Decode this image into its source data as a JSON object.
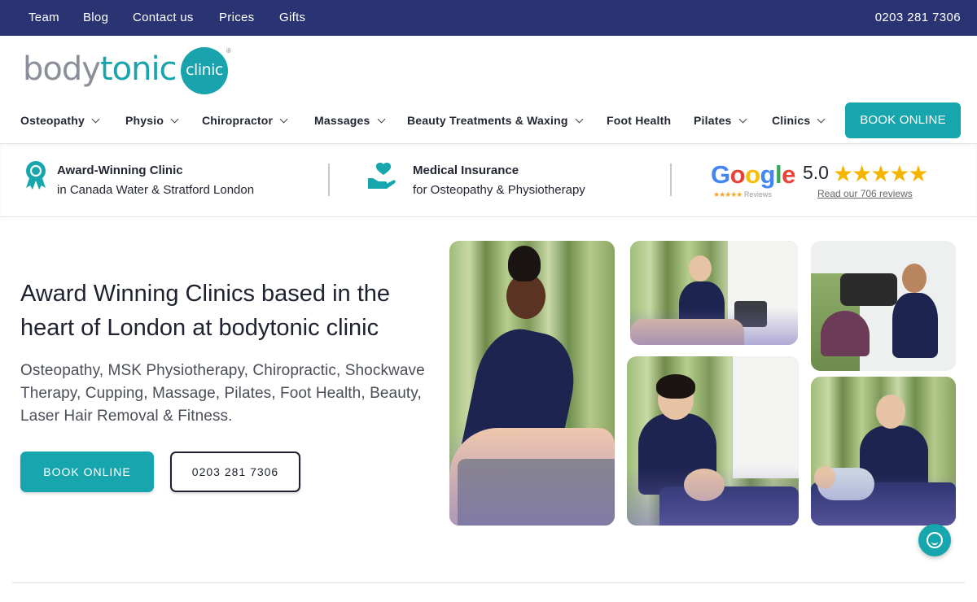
{
  "topbar": {
    "links": [
      "Team",
      "Blog",
      "Contact us",
      "Prices",
      "Gifts"
    ],
    "phone": "0203 281 7306"
  },
  "logo": {
    "word_prefix": "body",
    "word_suffix": "tonic",
    "badge": "clinic"
  },
  "nav": {
    "items": [
      {
        "label": "Osteopathy",
        "dropdown": true
      },
      {
        "label": "Physio",
        "dropdown": true
      },
      {
        "label": "Chiropractor",
        "dropdown": true
      },
      {
        "label": "Massages",
        "dropdown": true
      },
      {
        "label": "Beauty Treatments & Waxing",
        "dropdown": true
      },
      {
        "label": "Foot Health",
        "dropdown": false
      },
      {
        "label": "Pilates",
        "dropdown": true
      },
      {
        "label": "Clinics",
        "dropdown": true
      }
    ],
    "book_label": "BOOK ONLINE"
  },
  "trust": {
    "award_title": "Award-Winning Clinic",
    "award_sub": "in Canada Water & Stratford London",
    "insurance_title": "Medical Insurance",
    "insurance_sub": "for Osteopathy & Physiotherapy",
    "google_word": "Google",
    "google_sub": "Reviews",
    "rating": "5.0",
    "stars": 5,
    "reviews_link": "Read our 706 reviews"
  },
  "hero": {
    "title": "Award Winning Clinics based in the heart of London at bodytonic clinic",
    "subtitle": "Osteopathy, MSK Physiotherapy, Chiropractic, Shockwave Therapy, Cupping, Massage, Pilates, Foot Health, Beauty, Laser Hair Removal & Fitness.",
    "book_label": "BOOK ONLINE",
    "phone_label": "0203 281 7306"
  },
  "colors": {
    "topbar": "#2b3473",
    "accent": "#18a6ae",
    "text": "#1e2230",
    "star": "#f5b400"
  },
  "icons": [
    "award-icon",
    "insurance-heart-hand-icon",
    "google-logo",
    "chat-icon",
    "chevron-down-icon"
  ]
}
